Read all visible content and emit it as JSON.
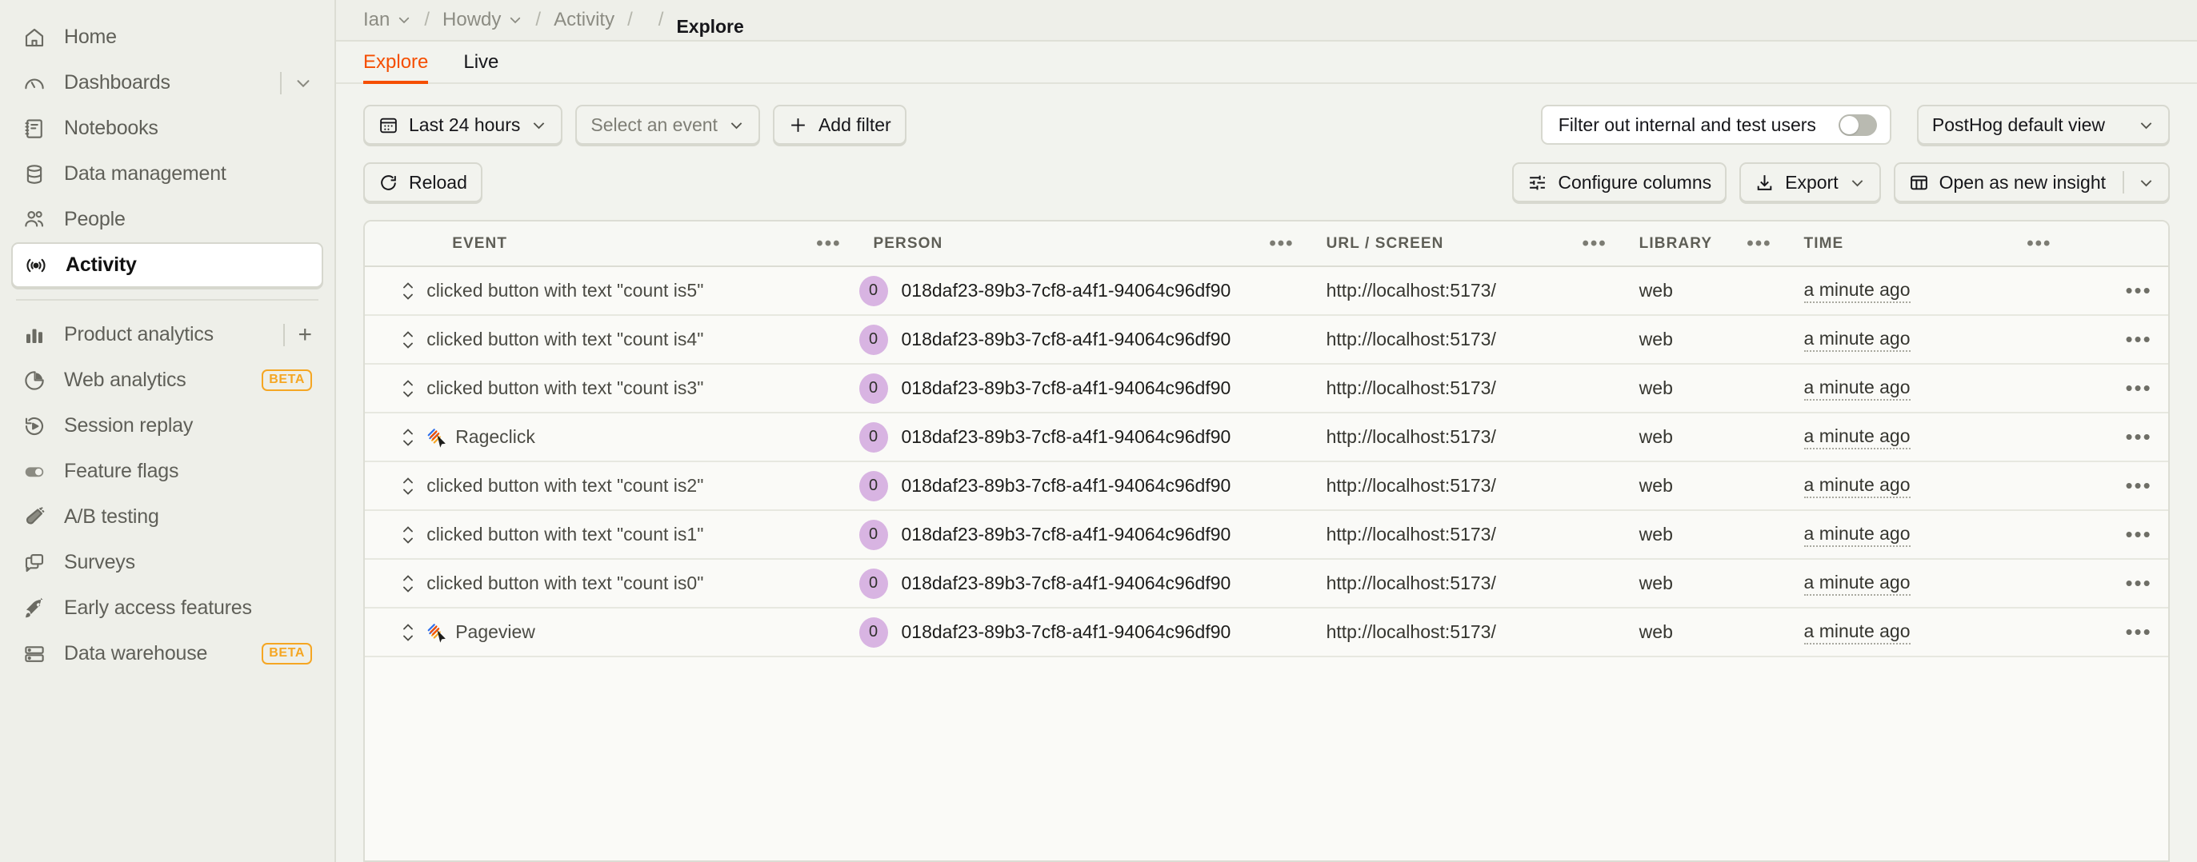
{
  "sidebar": {
    "items": [
      {
        "label": "Home",
        "icon": "home-icon",
        "active": false,
        "trailing": "none"
      },
      {
        "label": "Dashboards",
        "icon": "gauge-icon",
        "active": false,
        "trailing": "chevron"
      },
      {
        "label": "Notebooks",
        "icon": "notebook-icon",
        "active": false,
        "trailing": "none"
      },
      {
        "label": "Data management",
        "icon": "database-icon",
        "active": false,
        "trailing": "none"
      },
      {
        "label": "People",
        "icon": "people-icon",
        "active": false,
        "trailing": "none"
      },
      {
        "label": "Activity",
        "icon": "broadcast-icon",
        "active": true,
        "trailing": "none"
      }
    ],
    "items2": [
      {
        "label": "Product analytics",
        "icon": "bar-chart-icon",
        "active": false,
        "trailing": "plus"
      },
      {
        "label": "Web analytics",
        "icon": "pie-chart-icon",
        "active": false,
        "trailing": "beta",
        "badge": "BETA"
      },
      {
        "label": "Session replay",
        "icon": "replay-icon",
        "active": false,
        "trailing": "none"
      },
      {
        "label": "Feature flags",
        "icon": "toggle-icon",
        "active": false,
        "trailing": "none"
      },
      {
        "label": "A/B testing",
        "icon": "flask-icon",
        "active": false,
        "trailing": "none"
      },
      {
        "label": "Surveys",
        "icon": "chat-icon",
        "active": false,
        "trailing": "none"
      },
      {
        "label": "Early access features",
        "icon": "rocket-icon",
        "active": false,
        "trailing": "none"
      },
      {
        "label": "Data warehouse",
        "icon": "warehouse-icon",
        "active": false,
        "trailing": "beta",
        "badge": "BETA"
      }
    ]
  },
  "breadcrumb": {
    "items": [
      {
        "label": "Ian",
        "has_chevron": true
      },
      {
        "label": "Howdy",
        "has_chevron": true
      },
      {
        "label": "Activity",
        "has_chevron": false
      }
    ],
    "current": "Explore",
    "separator": "/"
  },
  "tabs": [
    {
      "label": "Explore",
      "active": true
    },
    {
      "label": "Live",
      "active": false
    }
  ],
  "filters": {
    "date_range": "Last 24 hours",
    "date_range_icon": "calendar-icon",
    "event_select": "Select an event",
    "add_filter": "Add filter",
    "add_filter_icon": "plus-icon",
    "internal_users_label": "Filter out internal and test users",
    "internal_users_gear_icon": "gear-icon",
    "internal_users_toggle_on": false,
    "view_select": "PostHog default view"
  },
  "actions": {
    "reload": "Reload",
    "reload_icon": "refresh-icon",
    "configure_columns": "Configure columns",
    "configure_columns_icon": "sliders-icon",
    "export": "Export",
    "export_icon": "download-icon",
    "open_insight": "Open as new insight",
    "open_insight_icon": "table-icon"
  },
  "table": {
    "columns": [
      {
        "key": "expand",
        "label": ""
      },
      {
        "key": "event",
        "label": "EVENT"
      },
      {
        "key": "person",
        "label": "PERSON"
      },
      {
        "key": "url",
        "label": "URL / SCREEN"
      },
      {
        "key": "library",
        "label": "LIBRARY"
      },
      {
        "key": "time",
        "label": "TIME"
      }
    ],
    "header_menu_glyph": "•••",
    "row_menu_glyph": "•••",
    "rows": [
      {
        "event": "clicked button with text \"count is5\"",
        "event_icon": "none",
        "person_badge": "0",
        "person": "018daf23-89b3-7cf8-a4f1-94064c96df90",
        "url": "http://localhost:5173/",
        "library": "web",
        "time": "a minute ago"
      },
      {
        "event": "clicked button with text \"count is4\"",
        "event_icon": "none",
        "person_badge": "0",
        "person": "018daf23-89b3-7cf8-a4f1-94064c96df90",
        "url": "http://localhost:5173/",
        "library": "web",
        "time": "a minute ago"
      },
      {
        "event": "clicked button with text \"count is3\"",
        "event_icon": "none",
        "person_badge": "0",
        "person": "018daf23-89b3-7cf8-a4f1-94064c96df90",
        "url": "http://localhost:5173/",
        "library": "web",
        "time": "a minute ago"
      },
      {
        "event": "Rageclick",
        "event_icon": "rageclick-cursor-icon",
        "person_badge": "0",
        "person": "018daf23-89b3-7cf8-a4f1-94064c96df90",
        "url": "http://localhost:5173/",
        "library": "web",
        "time": "a minute ago"
      },
      {
        "event": "clicked button with text \"count is2\"",
        "event_icon": "none",
        "person_badge": "0",
        "person": "018daf23-89b3-7cf8-a4f1-94064c96df90",
        "url": "http://localhost:5173/",
        "library": "web",
        "time": "a minute ago"
      },
      {
        "event": "clicked button with text \"count is1\"",
        "event_icon": "none",
        "person_badge": "0",
        "person": "018daf23-89b3-7cf8-a4f1-94064c96df90",
        "url": "http://localhost:5173/",
        "library": "web",
        "time": "a minute ago"
      },
      {
        "event": "clicked button with text \"count is0\"",
        "event_icon": "none",
        "person_badge": "0",
        "person": "018daf23-89b3-7cf8-a4f1-94064c96df90",
        "url": "http://localhost:5173/",
        "library": "web",
        "time": "a minute ago"
      },
      {
        "event": "Pageview",
        "event_icon": "pageview-cursor-icon",
        "person_badge": "0",
        "person": "018daf23-89b3-7cf8-a4f1-94064c96df90",
        "url": "http://localhost:5173/",
        "library": "web",
        "time": "a minute ago"
      }
    ]
  },
  "colors": {
    "accent": "#F54E00",
    "beta": "#F5A623",
    "sidebar_bg": "#EEEFE9",
    "content_bg": "#F2F3EE",
    "table_bg": "#FAFAF7",
    "person_badge": "#D8B4E2"
  }
}
